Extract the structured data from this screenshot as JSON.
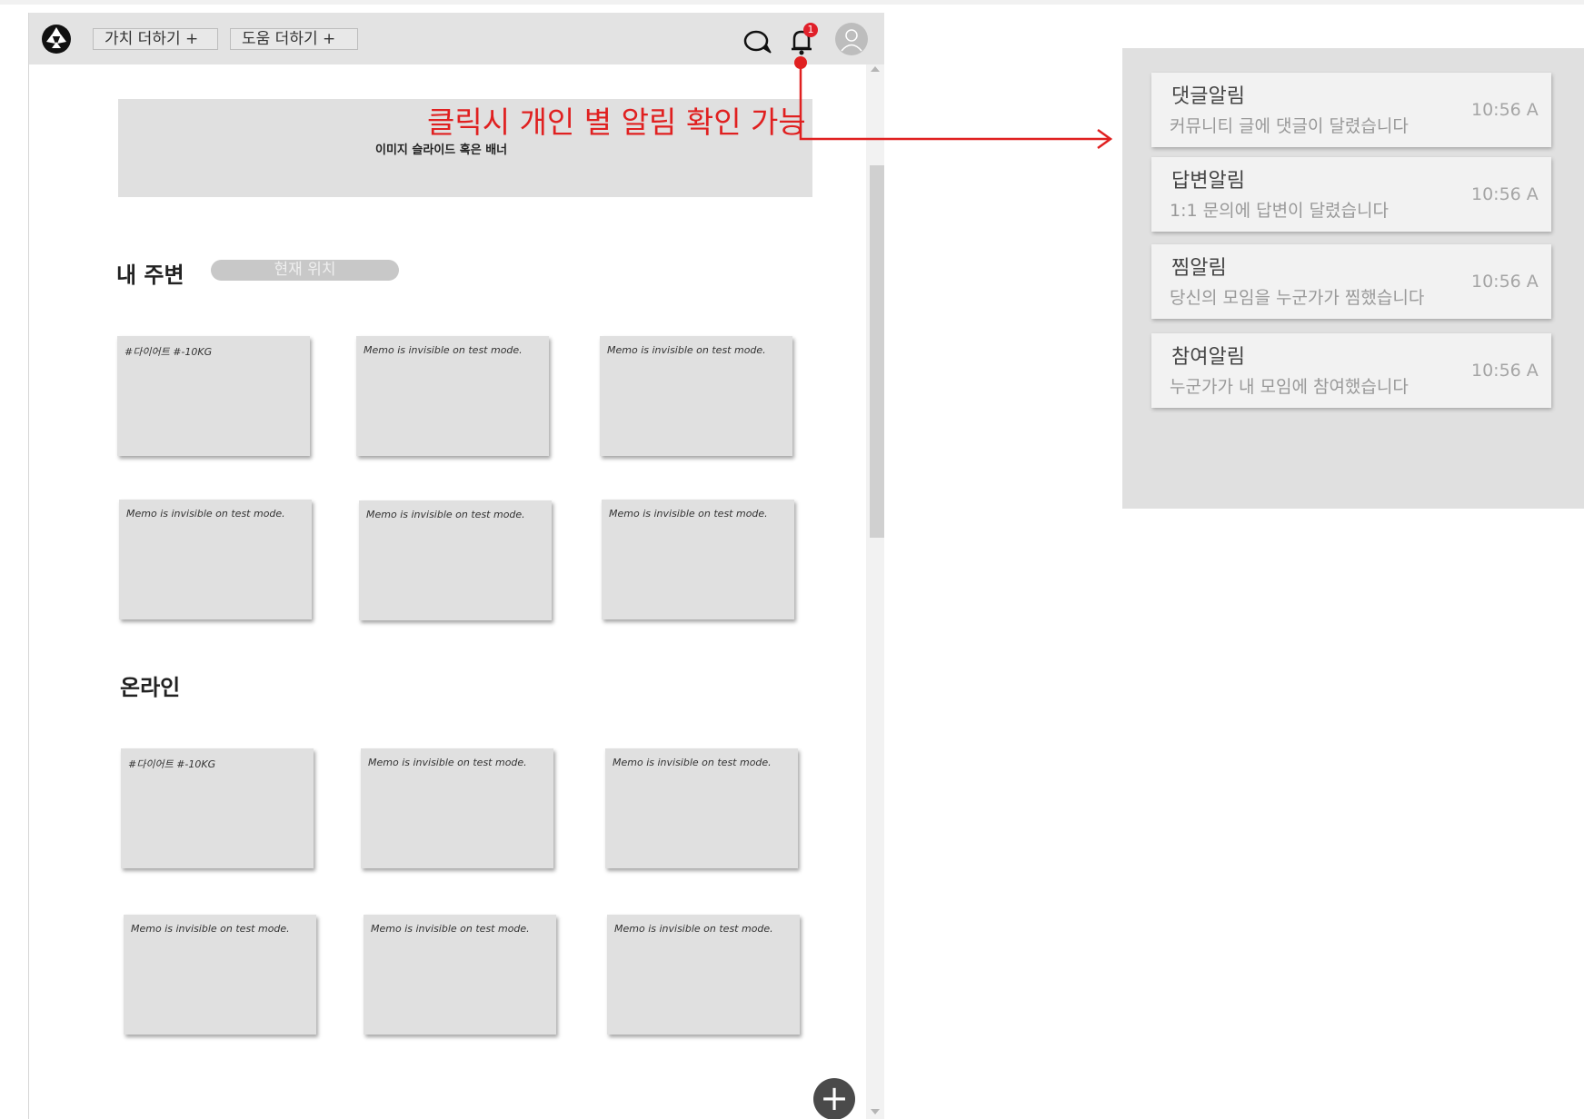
{
  "header": {
    "add_value_label": "가치 더하기 +",
    "add_help_label": "도움 더하기 +",
    "notification_count": "1"
  },
  "banner": {
    "text": "이미지 슬라이드 혹은 배너"
  },
  "nearby": {
    "title": "내 주변",
    "location_label": "현재 위치",
    "cards": [
      "#다이어트 #-10KG",
      "Memo is invisible on test mode.",
      "Memo is invisible on test mode.",
      "Memo is invisible on test mode.",
      "Memo is invisible on test mode.",
      "Memo is invisible on test mode."
    ]
  },
  "online": {
    "title": "온라인",
    "cards": [
      "#다이어트 #-10KG",
      "Memo is invisible on test mode.",
      "Memo is invisible on test mode.",
      "Memo is invisible on test mode.",
      "Memo is invisible on test mode.",
      "Memo is invisible on test mode."
    ]
  },
  "fab": {
    "label": "+"
  },
  "annotation": {
    "text": "클릭시 개인 별 알림 확인 가능",
    "color": "#e02020"
  },
  "notifications": [
    {
      "title": "댓글알림",
      "body": "커뮤니티 글에 댓글이 달렸습니다",
      "time": "10:56 A"
    },
    {
      "title": "답변알림",
      "body": "1:1 문의에 답변이 달렸습니다",
      "time": "10:56 A"
    },
    {
      "title": "찜알림",
      "body": "당신의 모임을 누군가가 찜했습니다",
      "time": "10:56 A"
    },
    {
      "title": "참여알림",
      "body": "누군가가 내 모임에 참여했습니다",
      "time": "10:56 A"
    }
  ]
}
